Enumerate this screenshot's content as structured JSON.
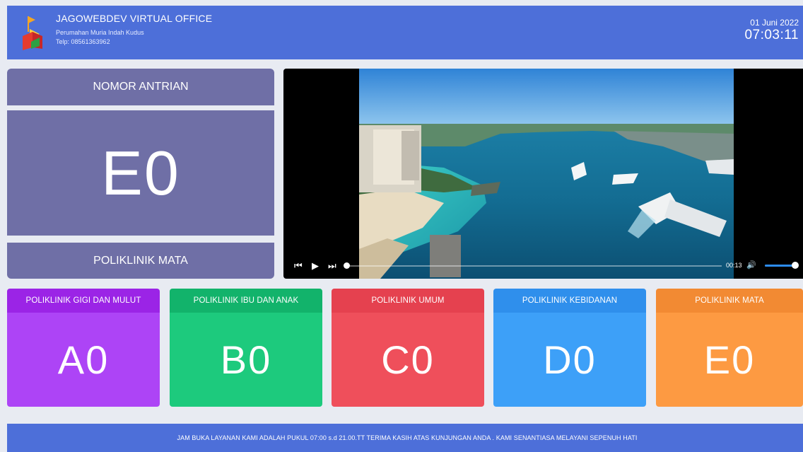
{
  "header": {
    "title": "JAGOWEBDEV VIRTUAL OFFICE",
    "address": "Perumahan Muria Indah Kudus",
    "phone": "Telp: 08561363962",
    "date": "01 Juni 2022",
    "time": "07:03:11"
  },
  "queue": {
    "heading": "NOMOR ANTRIAN",
    "current_number": "E0",
    "clinic": "POLIKLINIK MATA"
  },
  "video": {
    "elapsed": "00:13",
    "progress_fraction": 0.0,
    "volume_fraction": 0.95,
    "icons": [
      "skip-back-icon",
      "play-icon",
      "skip-forward-icon",
      "volume-icon"
    ]
  },
  "clinics": [
    {
      "name": "POLIKLINIK GIGI DAN MULUT",
      "number": "A0",
      "header_color": "#9b24e6",
      "body_color": "#ad44f6"
    },
    {
      "name": "POLIKLINIK IBU DAN ANAK",
      "number": "B0",
      "header_color": "#12b36b",
      "body_color": "#1dca7d"
    },
    {
      "name": "POLIKLINIK UMUM",
      "number": "C0",
      "header_color": "#e5414f",
      "body_color": "#ef4f5b"
    },
    {
      "name": "POLIKLINIK KEBIDANAN",
      "number": "D0",
      "header_color": "#2f8fec",
      "body_color": "#3da0f8"
    },
    {
      "name": "POLIKLINIK MATA",
      "number": "E0",
      "header_color": "#f28a33",
      "body_color": "#fd9a42"
    }
  ],
  "footer": {
    "marquee": "JAM BUKA LAYANAN KAMI ADALAH PUKUL 07:00 s.d 21.00.TT TERIMA KASIH ATAS KUNJUNGAN ANDA . KAMI SENANTIASA MELAYANI SEPENUH HATI"
  },
  "colors": {
    "header_bg": "#4d6fd9",
    "panel_bg": "#6f6fa6",
    "page_bg": "#e8ebf2"
  }
}
